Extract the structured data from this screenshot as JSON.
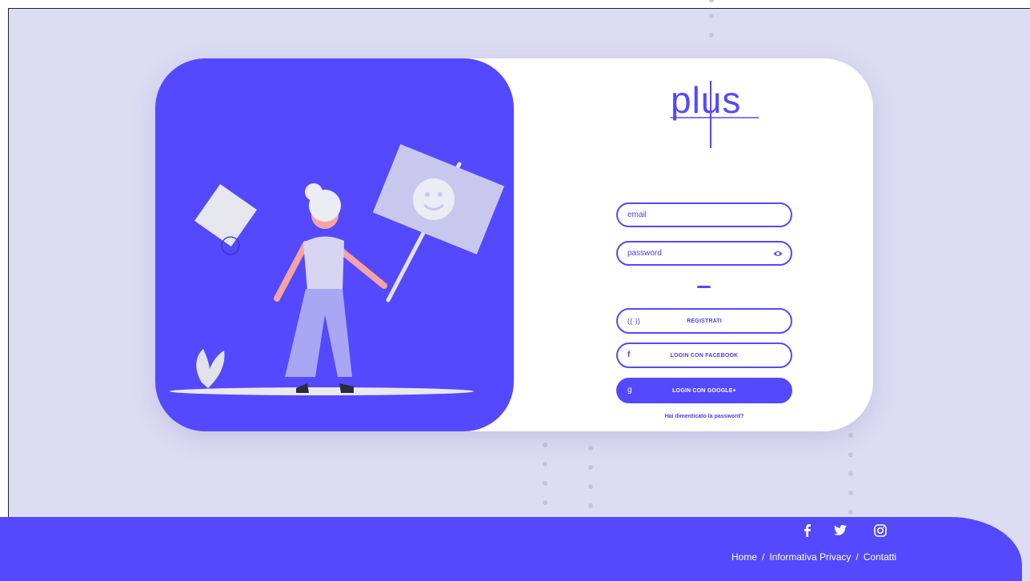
{
  "brand": {
    "logo_text": "plus",
    "accent_color": "#5449ff",
    "background_color": "#dcdcf3"
  },
  "form": {
    "email_placeholder": "email",
    "password_placeholder": "password",
    "password_toggle_icon": "eye-icon"
  },
  "buttons": {
    "register_label": "REGISTRATI",
    "register_icon": "wifi-icon",
    "facebook_label": "LOGIN CON FACEBOOK",
    "facebook_icon": "facebook-icon",
    "google_label": "LOGIN CON GOOGLE+",
    "google_icon": "google-icon"
  },
  "forgot_password_link": "Hai dimenticato la password?",
  "footer": {
    "social_icons": [
      "facebook-icon",
      "twitter-icon",
      "instagram-icon"
    ],
    "links": [
      "Home",
      "Informativa Privacy",
      "Contatti"
    ],
    "separator": "/"
  }
}
